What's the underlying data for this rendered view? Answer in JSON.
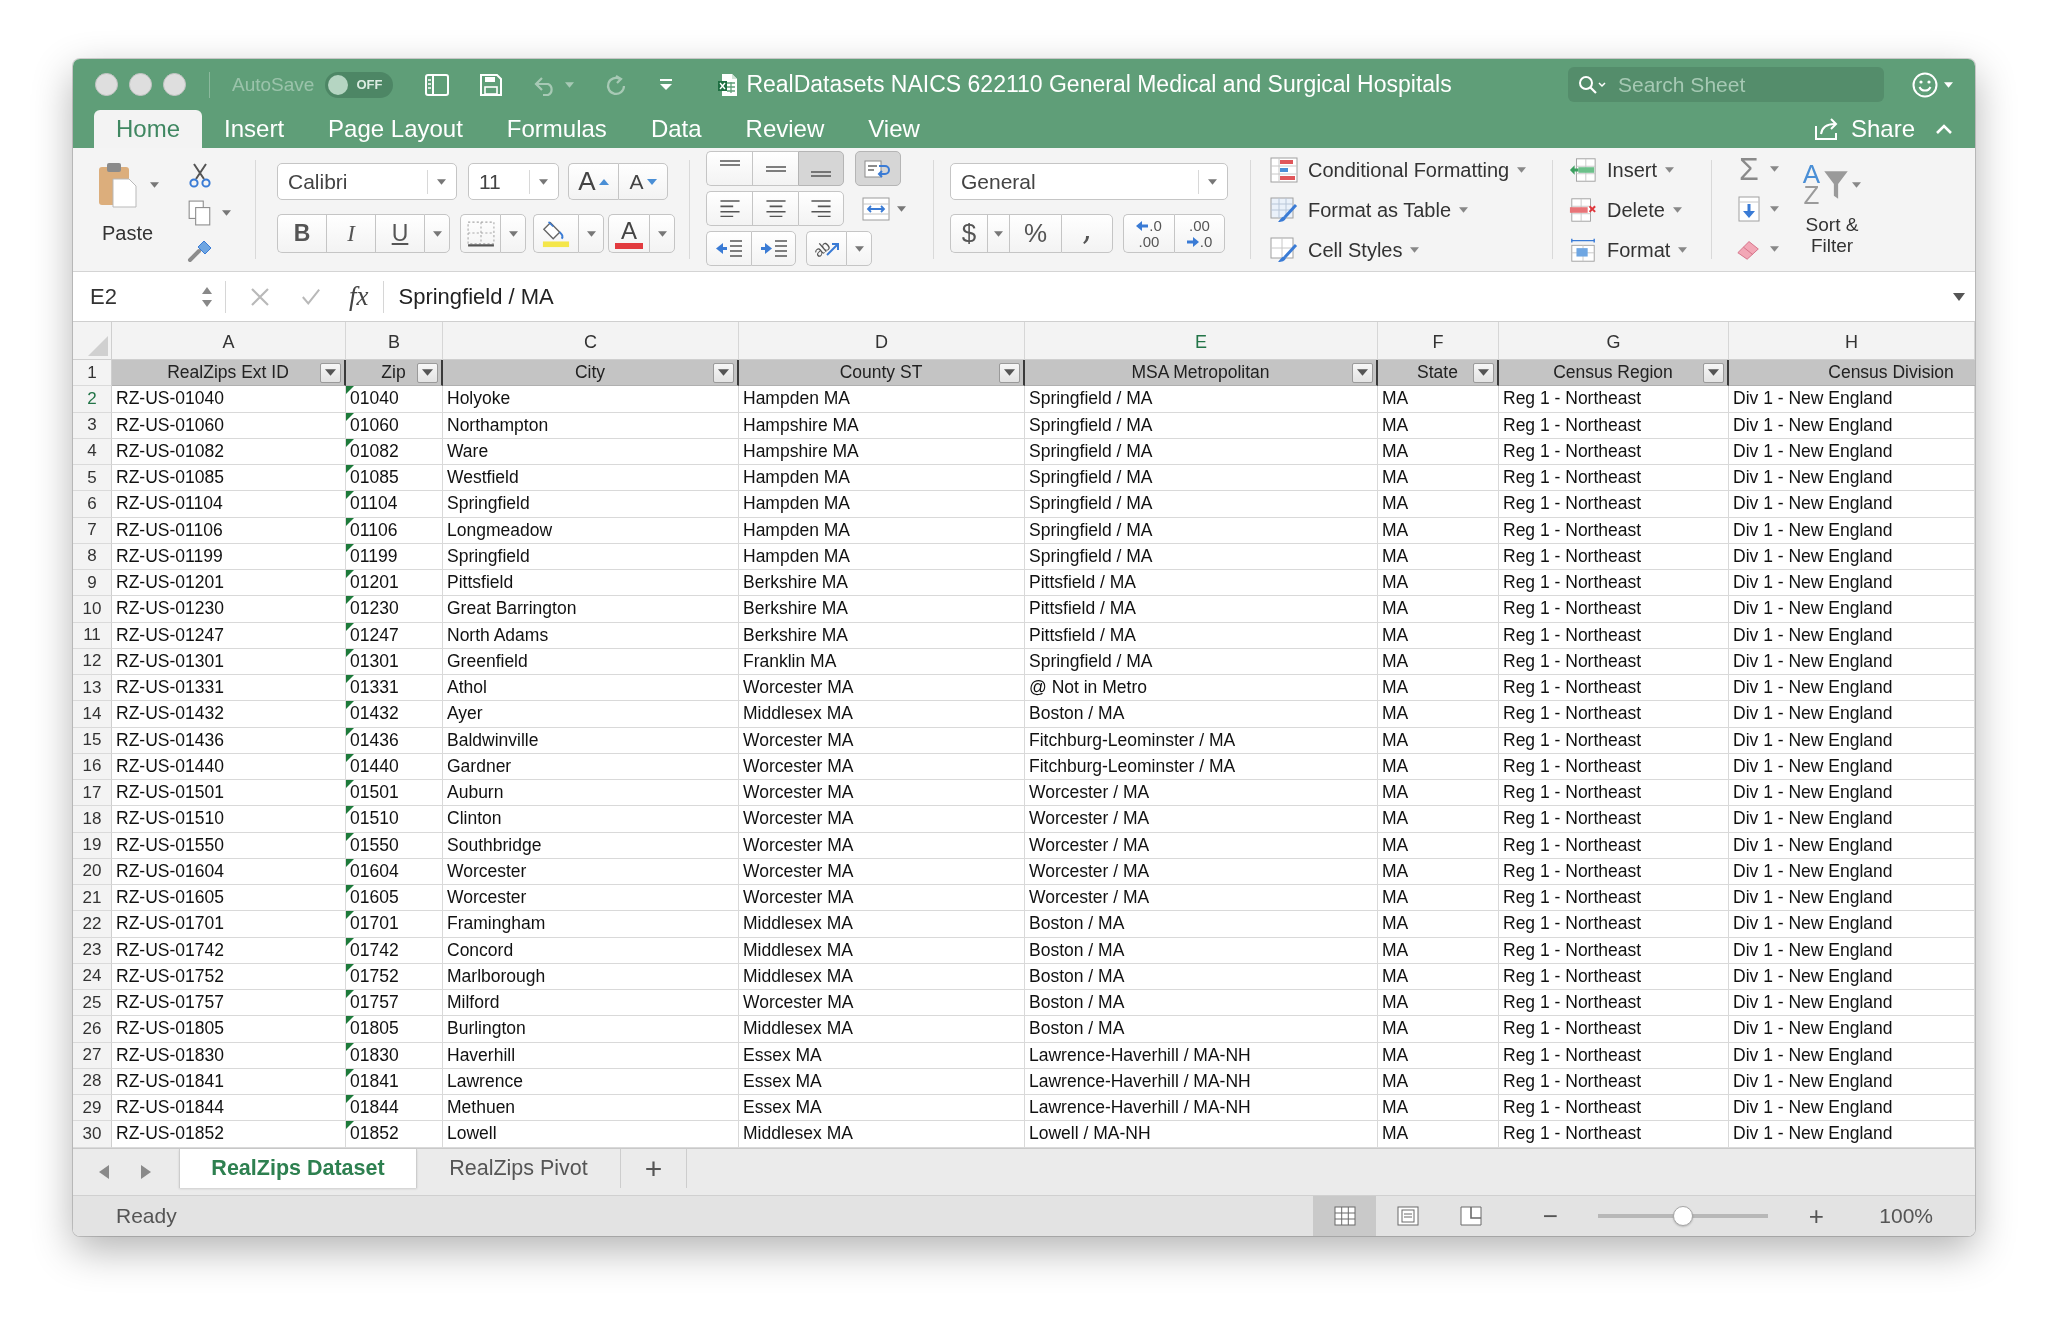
{
  "window": {
    "title": "RealDatasets NAICS 622110 General Medical and Surgical Hospitals"
  },
  "titlebar": {
    "autosave": {
      "label": "AutoSave",
      "disabled": true,
      "on": false,
      "state": "OFF"
    },
    "quick_access": [
      {
        "kind": "sidebar",
        "disabled": false
      },
      {
        "kind": "save",
        "disabled": false
      },
      {
        "kind": "undo",
        "disabled": true
      },
      {
        "kind": "redo",
        "disabled": true
      },
      {
        "kind": "customize",
        "disabled": false
      }
    ],
    "search": {
      "placeholder": "Search Sheet"
    }
  },
  "ribbon_tabs": [
    {
      "label": "Home",
      "selected": true
    },
    {
      "label": "Insert",
      "selected": false
    },
    {
      "label": "Page Layout",
      "selected": false
    },
    {
      "label": "Formulas",
      "selected": false
    },
    {
      "label": "Data",
      "selected": false
    },
    {
      "label": "Review",
      "selected": false
    },
    {
      "label": "View",
      "selected": false
    }
  ],
  "share": {
    "label": "Share"
  },
  "ribbon": {
    "clipboard": {
      "paste": "Paste"
    },
    "font": {
      "name": "Calibri",
      "size": "11",
      "grow": "A",
      "shrink": "A",
      "bold": "B",
      "italic": "I",
      "underline": "U",
      "font_color": "A"
    },
    "alignment": {
      "vertical": [
        {
          "kind": "top",
          "pressed": false
        },
        {
          "kind": "middle",
          "pressed": false
        },
        {
          "kind": "bottom",
          "pressed": true
        }
      ],
      "wrap_text": {
        "pressed": true
      },
      "orientation": "ab"
    },
    "number": {
      "format": "General",
      "currency": "$",
      "percent": "%",
      "comma": ",",
      "decimals": [
        {
          "kind": "increase",
          "top": ".0",
          "bottom": ".00"
        },
        {
          "kind": "decrease",
          "top": ".00",
          "bottom": ".0"
        }
      ]
    },
    "styles": [
      {
        "kind": "conditional_formatting",
        "label": "Conditional Formatting"
      },
      {
        "kind": "format_as_table",
        "label": "Format as Table"
      },
      {
        "kind": "cell_styles",
        "label": "Cell Styles"
      }
    ],
    "cells": [
      {
        "kind": "insert",
        "label": "Insert"
      },
      {
        "kind": "delete",
        "label": "Delete"
      },
      {
        "kind": "format",
        "label": "Format"
      }
    ],
    "editing": {
      "sum": "Σ",
      "sort_letters": [
        "A",
        "Z"
      ],
      "sort_filter": "Sort & Filter"
    }
  },
  "formula_bar": {
    "name_box": "E2",
    "buttons": [
      {
        "kind": "cancel",
        "disabled": true
      },
      {
        "kind": "enter",
        "disabled": true
      }
    ],
    "function_label": "fx",
    "value": "Springfield / MA"
  },
  "sheet": {
    "columns": [
      {
        "letter": "A",
        "selected": false,
        "header": "RealZips Ext ID",
        "filter": true,
        "error_flags": false
      },
      {
        "letter": "B",
        "selected": false,
        "header": "Zip",
        "filter": true,
        "error_flags": true
      },
      {
        "letter": "C",
        "selected": false,
        "header": "City",
        "filter": true,
        "error_flags": false
      },
      {
        "letter": "D",
        "selected": false,
        "header": "County ST",
        "filter": true,
        "error_flags": false
      },
      {
        "letter": "E",
        "selected": true,
        "header": "MSA Metropolitan",
        "filter": true,
        "error_flags": false
      },
      {
        "letter": "F",
        "selected": false,
        "header": "State",
        "filter": true,
        "error_flags": false
      },
      {
        "letter": "G",
        "selected": false,
        "header": "Census Region",
        "filter": true,
        "error_flags": false
      },
      {
        "letter": "H",
        "selected": false,
        "header": "Census Division",
        "filter": false,
        "error_flags": false
      }
    ],
    "header_row_number": "1",
    "rows": [
      {
        "number": "2",
        "selected": true,
        "cells": [
          "RZ-US-01040",
          "01040",
          "Holyoke",
          "Hampden MA",
          "Springfield / MA",
          "MA",
          "Reg 1 - Northeast",
          "Div 1 - New England"
        ]
      },
      {
        "number": "3",
        "selected": false,
        "cells": [
          "RZ-US-01060",
          "01060",
          "Northampton",
          "Hampshire MA",
          "Springfield / MA",
          "MA",
          "Reg 1 - Northeast",
          "Div 1 - New England"
        ]
      },
      {
        "number": "4",
        "selected": false,
        "cells": [
          "RZ-US-01082",
          "01082",
          "Ware",
          "Hampshire MA",
          "Springfield / MA",
          "MA",
          "Reg 1 - Northeast",
          "Div 1 - New England"
        ]
      },
      {
        "number": "5",
        "selected": false,
        "cells": [
          "RZ-US-01085",
          "01085",
          "Westfield",
          "Hampden MA",
          "Springfield / MA",
          "MA",
          "Reg 1 - Northeast",
          "Div 1 - New England"
        ]
      },
      {
        "number": "6",
        "selected": false,
        "cells": [
          "RZ-US-01104",
          "01104",
          "Springfield",
          "Hampden MA",
          "Springfield / MA",
          "MA",
          "Reg 1 - Northeast",
          "Div 1 - New England"
        ]
      },
      {
        "number": "7",
        "selected": false,
        "cells": [
          "RZ-US-01106",
          "01106",
          "Longmeadow",
          "Hampden MA",
          "Springfield / MA",
          "MA",
          "Reg 1 - Northeast",
          "Div 1 - New England"
        ]
      },
      {
        "number": "8",
        "selected": false,
        "cells": [
          "RZ-US-01199",
          "01199",
          "Springfield",
          "Hampden MA",
          "Springfield / MA",
          "MA",
          "Reg 1 - Northeast",
          "Div 1 - New England"
        ]
      },
      {
        "number": "9",
        "selected": false,
        "cells": [
          "RZ-US-01201",
          "01201",
          "Pittsfield",
          "Berkshire MA",
          "Pittsfield / MA",
          "MA",
          "Reg 1 - Northeast",
          "Div 1 - New England"
        ]
      },
      {
        "number": "10",
        "selected": false,
        "cells": [
          "RZ-US-01230",
          "01230",
          "Great Barrington",
          "Berkshire MA",
          "Pittsfield / MA",
          "MA",
          "Reg 1 - Northeast",
          "Div 1 - New England"
        ]
      },
      {
        "number": "11",
        "selected": false,
        "cells": [
          "RZ-US-01247",
          "01247",
          "North Adams",
          "Berkshire MA",
          "Pittsfield / MA",
          "MA",
          "Reg 1 - Northeast",
          "Div 1 - New England"
        ]
      },
      {
        "number": "12",
        "selected": false,
        "cells": [
          "RZ-US-01301",
          "01301",
          "Greenfield",
          "Franklin MA",
          "Springfield / MA",
          "MA",
          "Reg 1 - Northeast",
          "Div 1 - New England"
        ]
      },
      {
        "number": "13",
        "selected": false,
        "cells": [
          "RZ-US-01331",
          "01331",
          "Athol",
          "Worcester MA",
          "@ Not in Metro",
          "MA",
          "Reg 1 - Northeast",
          "Div 1 - New England"
        ]
      },
      {
        "number": "14",
        "selected": false,
        "cells": [
          "RZ-US-01432",
          "01432",
          "Ayer",
          "Middlesex MA",
          "Boston / MA",
          "MA",
          "Reg 1 - Northeast",
          "Div 1 - New England"
        ]
      },
      {
        "number": "15",
        "selected": false,
        "cells": [
          "RZ-US-01436",
          "01436",
          "Baldwinville",
          "Worcester MA",
          "Fitchburg-Leominster / MA",
          "MA",
          "Reg 1 - Northeast",
          "Div 1 - New England"
        ]
      },
      {
        "number": "16",
        "selected": false,
        "cells": [
          "RZ-US-01440",
          "01440",
          "Gardner",
          "Worcester MA",
          "Fitchburg-Leominster / MA",
          "MA",
          "Reg 1 - Northeast",
          "Div 1 - New England"
        ]
      },
      {
        "number": "17",
        "selected": false,
        "cells": [
          "RZ-US-01501",
          "01501",
          "Auburn",
          "Worcester MA",
          "Worcester / MA",
          "MA",
          "Reg 1 - Northeast",
          "Div 1 - New England"
        ]
      },
      {
        "number": "18",
        "selected": false,
        "cells": [
          "RZ-US-01510",
          "01510",
          "Clinton",
          "Worcester MA",
          "Worcester / MA",
          "MA",
          "Reg 1 - Northeast",
          "Div 1 - New England"
        ]
      },
      {
        "number": "19",
        "selected": false,
        "cells": [
          "RZ-US-01550",
          "01550",
          "Southbridge",
          "Worcester MA",
          "Worcester / MA",
          "MA",
          "Reg 1 - Northeast",
          "Div 1 - New England"
        ]
      },
      {
        "number": "20",
        "selected": false,
        "cells": [
          "RZ-US-01604",
          "01604",
          "Worcester",
          "Worcester MA",
          "Worcester / MA",
          "MA",
          "Reg 1 - Northeast",
          "Div 1 - New England"
        ]
      },
      {
        "number": "21",
        "selected": false,
        "cells": [
          "RZ-US-01605",
          "01605",
          "Worcester",
          "Worcester MA",
          "Worcester / MA",
          "MA",
          "Reg 1 - Northeast",
          "Div 1 - New England"
        ]
      },
      {
        "number": "22",
        "selected": false,
        "cells": [
          "RZ-US-01701",
          "01701",
          "Framingham",
          "Middlesex MA",
          "Boston / MA",
          "MA",
          "Reg 1 - Northeast",
          "Div 1 - New England"
        ]
      },
      {
        "number": "23",
        "selected": false,
        "cells": [
          "RZ-US-01742",
          "01742",
          "Concord",
          "Middlesex MA",
          "Boston / MA",
          "MA",
          "Reg 1 - Northeast",
          "Div 1 - New England"
        ]
      },
      {
        "number": "24",
        "selected": false,
        "cells": [
          "RZ-US-01752",
          "01752",
          "Marlborough",
          "Middlesex MA",
          "Boston / MA",
          "MA",
          "Reg 1 - Northeast",
          "Div 1 - New England"
        ]
      },
      {
        "number": "25",
        "selected": false,
        "cells": [
          "RZ-US-01757",
          "01757",
          "Milford",
          "Worcester MA",
          "Boston / MA",
          "MA",
          "Reg 1 - Northeast",
          "Div 1 - New England"
        ]
      },
      {
        "number": "26",
        "selected": false,
        "cells": [
          "RZ-US-01805",
          "01805",
          "Burlington",
          "Middlesex MA",
          "Boston / MA",
          "MA",
          "Reg 1 - Northeast",
          "Div 1 - New England"
        ]
      },
      {
        "number": "27",
        "selected": false,
        "cells": [
          "RZ-US-01830",
          "01830",
          "Haverhill",
          "Essex MA",
          "Lawrence-Haverhill / MA-NH",
          "MA",
          "Reg 1 - Northeast",
          "Div 1 - New England"
        ]
      },
      {
        "number": "28",
        "selected": false,
        "cells": [
          "RZ-US-01841",
          "01841",
          "Lawrence",
          "Essex MA",
          "Lawrence-Haverhill / MA-NH",
          "MA",
          "Reg 1 - Northeast",
          "Div 1 - New England"
        ]
      },
      {
        "number": "29",
        "selected": false,
        "cells": [
          "RZ-US-01844",
          "01844",
          "Methuen",
          "Essex MA",
          "Lawrence-Haverhill / MA-NH",
          "MA",
          "Reg 1 - Northeast",
          "Div 1 - New England"
        ]
      },
      {
        "number": "30",
        "selected": false,
        "cells": [
          "RZ-US-01852",
          "01852",
          "Lowell",
          "Middlesex MA",
          "Lowell / MA-NH",
          "MA",
          "Reg 1 - Northeast",
          "Div 1 - New England"
        ]
      }
    ]
  },
  "sheet_tabs": [
    {
      "label": "RealZips Dataset",
      "selected": true
    },
    {
      "label": "RealZips Pivot",
      "selected": false
    }
  ],
  "add_sheet": "+",
  "status_bar": {
    "status": "Ready",
    "views": [
      {
        "kind": "normal",
        "selected": true
      },
      {
        "kind": "page_layout",
        "selected": false
      },
      {
        "kind": "page_break_preview",
        "selected": false
      }
    ],
    "zoom_out": "−",
    "zoom_slider": {
      "level": 0.5
    },
    "zoom_in": "+",
    "zoom": "100%"
  }
}
